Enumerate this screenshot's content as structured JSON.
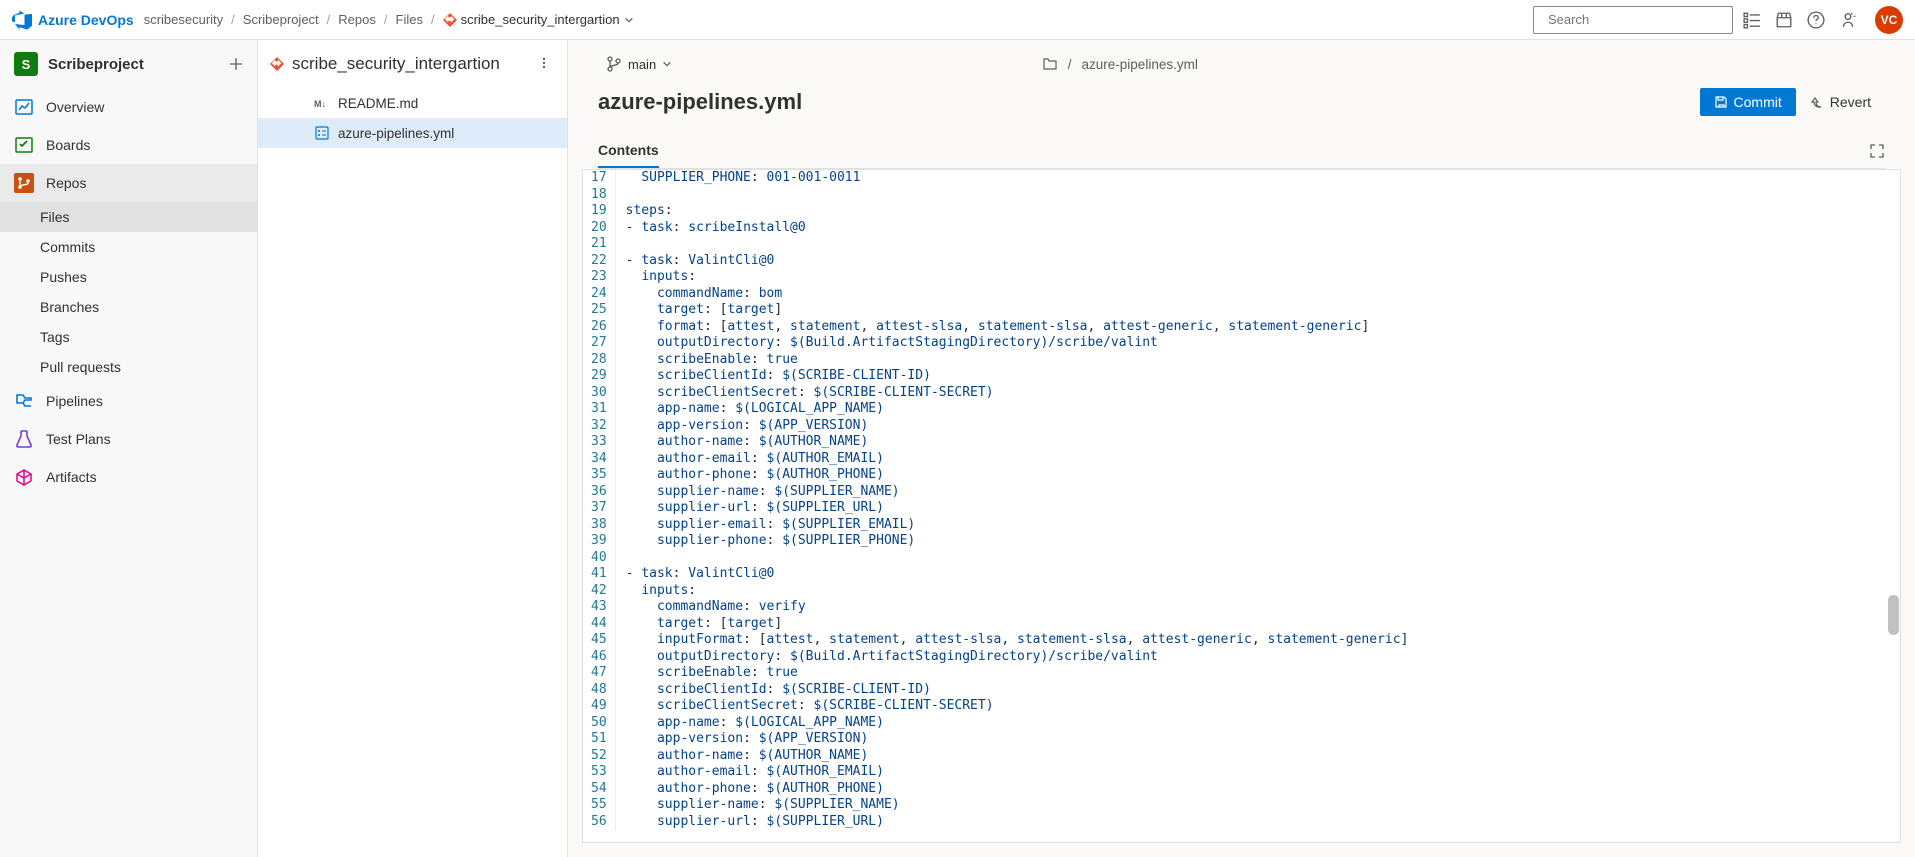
{
  "brand": "Azure DevOps",
  "breadcrumb": [
    "scribesecurity",
    "Scribeproject",
    "Repos",
    "Files"
  ],
  "breadcrumb_current": "scribe_security_intergartion",
  "search_placeholder": "Search",
  "avatar": "VC",
  "project": {
    "initial": "S",
    "name": "Scribeproject"
  },
  "nav": [
    {
      "label": "Overview",
      "icon": "overview",
      "color": "#0078d4",
      "bg": "transparent"
    },
    {
      "label": "Boards",
      "icon": "boards",
      "color": "#107c10",
      "bg": "transparent"
    },
    {
      "label": "Repos",
      "icon": "repos",
      "color": "#fff",
      "bg": "#ca5010",
      "selected": true
    }
  ],
  "nav_sub": [
    {
      "label": "Files",
      "selected": true
    },
    {
      "label": "Commits"
    },
    {
      "label": "Pushes"
    },
    {
      "label": "Branches"
    },
    {
      "label": "Tags"
    },
    {
      "label": "Pull requests"
    }
  ],
  "nav2": [
    {
      "label": "Pipelines",
      "icon": "pipelines",
      "color": "#0078d4"
    },
    {
      "label": "Test Plans",
      "icon": "testplans",
      "color": "#773adc"
    },
    {
      "label": "Artifacts",
      "icon": "artifacts",
      "color": "#e3008c"
    }
  ],
  "tree": {
    "title": "scribe_security_intergartion",
    "files": [
      {
        "name": "README.md",
        "icon": "md"
      },
      {
        "name": "azure-pipelines.yml",
        "icon": "yml",
        "selected": true
      }
    ]
  },
  "branch": "main",
  "path_file": "azure-pipelines.yml",
  "file_title": "azure-pipelines.yml",
  "commit_label": "Commit",
  "revert_label": "Revert",
  "tab_contents": "Contents",
  "code_start": 17,
  "code": [
    [
      [
        2,
        "  "
      ],
      [
        "key",
        "SUPPLIER_PHONE"
      ],
      [
        "p",
        ":"
      ],
      [
        "v",
        " 001-001-0011"
      ]
    ],
    [],
    [
      [
        "key",
        "steps"
      ],
      [
        "p",
        ":"
      ]
    ],
    [
      [
        "p",
        "- "
      ],
      [
        "key",
        "task"
      ],
      [
        "p",
        ": "
      ],
      [
        "v",
        "scribeInstall@0"
      ]
    ],
    [],
    [
      [
        "p",
        "- "
      ],
      [
        "key",
        "task"
      ],
      [
        "p",
        ": "
      ],
      [
        "v",
        "ValintCli@0"
      ]
    ],
    [
      [
        2,
        "  "
      ],
      [
        "key",
        "inputs"
      ],
      [
        "p",
        ":"
      ]
    ],
    [
      [
        4,
        "    "
      ],
      [
        "key",
        "commandName"
      ],
      [
        "p",
        ": "
      ],
      [
        "v",
        "bom"
      ]
    ],
    [
      [
        4,
        "    "
      ],
      [
        "key",
        "target"
      ],
      [
        "p",
        ": ["
      ],
      [
        "v",
        "target"
      ],
      [
        "p",
        "]"
      ]
    ],
    [
      [
        4,
        "    "
      ],
      [
        "key",
        "format"
      ],
      [
        "p",
        ": ["
      ],
      [
        "v",
        "attest"
      ],
      [
        "p",
        ", "
      ],
      [
        "v",
        "statement"
      ],
      [
        "p",
        ", "
      ],
      [
        "v",
        "attest-slsa"
      ],
      [
        "p",
        ", "
      ],
      [
        "v",
        "statement-slsa"
      ],
      [
        "p",
        ", "
      ],
      [
        "v",
        "attest-generic"
      ],
      [
        "p",
        ", "
      ],
      [
        "v",
        "statement-generic"
      ],
      [
        "p",
        "]"
      ]
    ],
    [
      [
        4,
        "    "
      ],
      [
        "key",
        "outputDirectory"
      ],
      [
        "p",
        ": "
      ],
      [
        "v",
        "$(Build.ArtifactStagingDirectory)/scribe/valint"
      ]
    ],
    [
      [
        4,
        "    "
      ],
      [
        "key",
        "scribeEnable"
      ],
      [
        "p",
        ": "
      ],
      [
        "v",
        "true"
      ]
    ],
    [
      [
        4,
        "    "
      ],
      [
        "key",
        "scribeClientId"
      ],
      [
        "p",
        ": "
      ],
      [
        "v",
        "$(SCRIBE-CLIENT-ID)"
      ]
    ],
    [
      [
        4,
        "    "
      ],
      [
        "key",
        "scribeClientSecret"
      ],
      [
        "p",
        ": "
      ],
      [
        "v",
        "$(SCRIBE-CLIENT-SECRET)"
      ]
    ],
    [
      [
        4,
        "    "
      ],
      [
        "key",
        "app-name"
      ],
      [
        "p",
        ": "
      ],
      [
        "v",
        "$(LOGICAL_APP_NAME)"
      ]
    ],
    [
      [
        4,
        "    "
      ],
      [
        "key",
        "app-version"
      ],
      [
        "p",
        ": "
      ],
      [
        "v",
        "$(APP_VERSION)"
      ]
    ],
    [
      [
        4,
        "    "
      ],
      [
        "key",
        "author-name"
      ],
      [
        "p",
        ": "
      ],
      [
        "v",
        "$(AUTHOR_NAME)"
      ]
    ],
    [
      [
        4,
        "    "
      ],
      [
        "key",
        "author-email"
      ],
      [
        "p",
        ": "
      ],
      [
        "v",
        "$(AUTHOR_EMAIL)"
      ]
    ],
    [
      [
        4,
        "    "
      ],
      [
        "key",
        "author-phone"
      ],
      [
        "p",
        ": "
      ],
      [
        "v",
        "$(AUTHOR_PHONE)"
      ]
    ],
    [
      [
        4,
        "    "
      ],
      [
        "key",
        "supplier-name"
      ],
      [
        "p",
        ": "
      ],
      [
        "v",
        "$(SUPPLIER_NAME)"
      ]
    ],
    [
      [
        4,
        "    "
      ],
      [
        "key",
        "supplier-url"
      ],
      [
        "p",
        ": "
      ],
      [
        "v",
        "$(SUPPLIER_URL)"
      ]
    ],
    [
      [
        4,
        "    "
      ],
      [
        "key",
        "supplier-email"
      ],
      [
        "p",
        ": "
      ],
      [
        "v",
        "$(SUPPLIER_EMAIL)"
      ]
    ],
    [
      [
        4,
        "    "
      ],
      [
        "key",
        "supplier-phone"
      ],
      [
        "p",
        ": "
      ],
      [
        "v",
        "$(SUPPLIER_PHONE)"
      ]
    ],
    [],
    [
      [
        "p",
        "- "
      ],
      [
        "key",
        "task"
      ],
      [
        "p",
        ": "
      ],
      [
        "v",
        "ValintCli@0"
      ]
    ],
    [
      [
        2,
        "  "
      ],
      [
        "key",
        "inputs"
      ],
      [
        "p",
        ":"
      ]
    ],
    [
      [
        4,
        "    "
      ],
      [
        "key",
        "commandName"
      ],
      [
        "p",
        ": "
      ],
      [
        "v",
        "verify"
      ]
    ],
    [
      [
        4,
        "    "
      ],
      [
        "key",
        "target"
      ],
      [
        "p",
        ": ["
      ],
      [
        "v",
        "target"
      ],
      [
        "p",
        "]"
      ]
    ],
    [
      [
        4,
        "    "
      ],
      [
        "key",
        "inputFormat"
      ],
      [
        "p",
        ": ["
      ],
      [
        "v",
        "attest"
      ],
      [
        "p",
        ", "
      ],
      [
        "v",
        "statement"
      ],
      [
        "p",
        ", "
      ],
      [
        "v",
        "attest-slsa"
      ],
      [
        "p",
        ", "
      ],
      [
        "v",
        "statement-slsa"
      ],
      [
        "p",
        ", "
      ],
      [
        "v",
        "attest-generic"
      ],
      [
        "p",
        ", "
      ],
      [
        "v",
        "statement-generic"
      ],
      [
        "p",
        "]"
      ]
    ],
    [
      [
        4,
        "    "
      ],
      [
        "key",
        "outputDirectory"
      ],
      [
        "p",
        ": "
      ],
      [
        "v",
        "$(Build.ArtifactStagingDirectory)/scribe/valint"
      ]
    ],
    [
      [
        4,
        "    "
      ],
      [
        "key",
        "scribeEnable"
      ],
      [
        "p",
        ": "
      ],
      [
        "v",
        "true"
      ]
    ],
    [
      [
        4,
        "    "
      ],
      [
        "key",
        "scribeClientId"
      ],
      [
        "p",
        ": "
      ],
      [
        "v",
        "$(SCRIBE-CLIENT-ID)"
      ]
    ],
    [
      [
        4,
        "    "
      ],
      [
        "key",
        "scribeClientSecret"
      ],
      [
        "p",
        ": "
      ],
      [
        "v",
        "$(SCRIBE-CLIENT-SECRET)"
      ]
    ],
    [
      [
        4,
        "    "
      ],
      [
        "key",
        "app-name"
      ],
      [
        "p",
        ": "
      ],
      [
        "v",
        "$(LOGICAL_APP_NAME)"
      ]
    ],
    [
      [
        4,
        "    "
      ],
      [
        "key",
        "app-version"
      ],
      [
        "p",
        ": "
      ],
      [
        "v",
        "$(APP_VERSION)"
      ]
    ],
    [
      [
        4,
        "    "
      ],
      [
        "key",
        "author-name"
      ],
      [
        "p",
        ": "
      ],
      [
        "v",
        "$(AUTHOR_NAME)"
      ]
    ],
    [
      [
        4,
        "    "
      ],
      [
        "key",
        "author-email"
      ],
      [
        "p",
        ": "
      ],
      [
        "v",
        "$(AUTHOR_EMAIL)"
      ]
    ],
    [
      [
        4,
        "    "
      ],
      [
        "key",
        "author-phone"
      ],
      [
        "p",
        ": "
      ],
      [
        "v",
        "$(AUTHOR_PHONE)"
      ]
    ],
    [
      [
        4,
        "    "
      ],
      [
        "key",
        "supplier-name"
      ],
      [
        "p",
        ": "
      ],
      [
        "v",
        "$(SUPPLIER_NAME)"
      ]
    ],
    [
      [
        4,
        "    "
      ],
      [
        "key",
        "supplier-url"
      ],
      [
        "p",
        ": "
      ],
      [
        "v",
        "$(SUPPLIER_URL)"
      ]
    ]
  ]
}
